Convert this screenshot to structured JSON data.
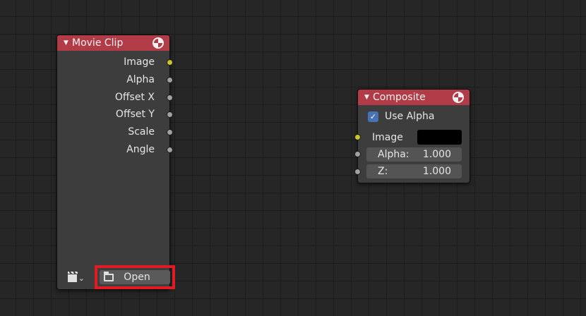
{
  "movie_clip_node": {
    "title": "Movie Clip",
    "outputs": [
      "Image",
      "Alpha",
      "Offset X",
      "Offset Y",
      "Scale",
      "Angle"
    ],
    "open_label": "Open",
    "browse_chevron": "⌄"
  },
  "composite_node": {
    "title": "Composite",
    "use_alpha_label": "Use Alpha",
    "use_alpha_checked": true,
    "image_label": "Image",
    "alpha_label": "Alpha:",
    "alpha_value": "1.000",
    "z_label": "Z:",
    "z_value": "1.000"
  },
  "colors": {
    "header": "#b13b47",
    "image_socket": "#c7c729",
    "highlight": "#e01b24",
    "checkbox": "#4772b3"
  }
}
